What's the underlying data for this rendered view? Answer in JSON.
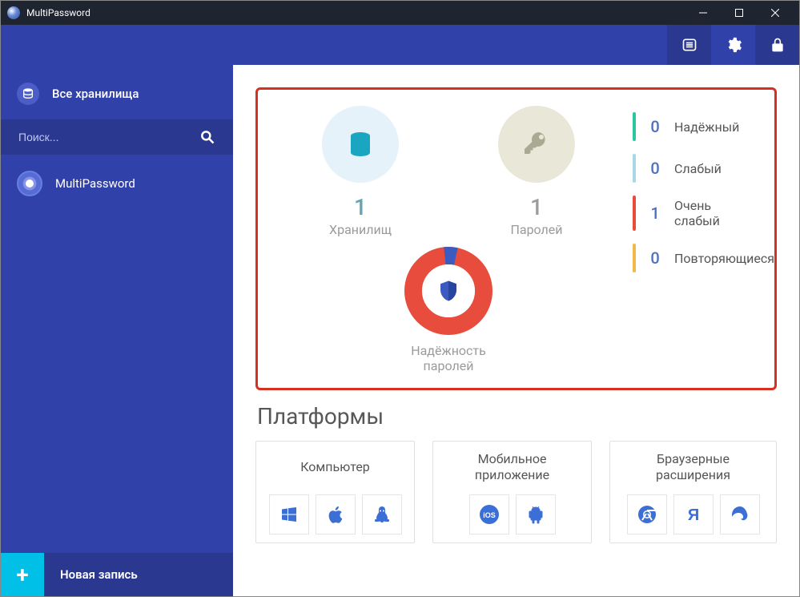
{
  "window": {
    "title": "MultiPassword"
  },
  "sidebar": {
    "all_vaults": "Все хранилища",
    "search_placeholder": "Поиск...",
    "vault_name": "MultiPassword",
    "new_entry": "Новая запись"
  },
  "dashboard": {
    "vaults": {
      "count": "1",
      "label": "Хранилищ"
    },
    "passwords": {
      "count": "1",
      "label": "Паролей"
    },
    "reliability_label": "Надёжность\nпаролей",
    "strength": [
      {
        "count": "0",
        "label": "Надёжный",
        "color": "#2bc6a0"
      },
      {
        "count": "0",
        "label": "Слабый",
        "color": "#a9d7e8"
      },
      {
        "count": "1",
        "label": "Очень\nслабый",
        "color": "#e74c3c"
      },
      {
        "count": "0",
        "label": "Повторяющиеся",
        "color": "#f0b94a"
      }
    ]
  },
  "platforms": {
    "title": "Платформы",
    "cards": [
      {
        "title": "Компьютер",
        "icons": [
          "windows",
          "apple",
          "linux"
        ]
      },
      {
        "title": "Мобильное\nприложение",
        "icons": [
          "ios",
          "android"
        ]
      },
      {
        "title": "Браузерные\nрасширения",
        "icons": [
          "chrome",
          "yandex",
          "edge"
        ]
      }
    ]
  }
}
